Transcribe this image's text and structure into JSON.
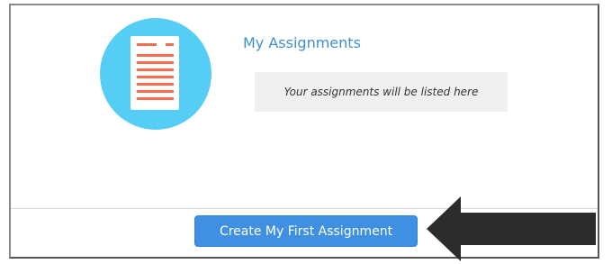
{
  "card": {
    "icon": "assignment-document-icon",
    "title": "My Assignments",
    "empty_message": "Your assignments will be listed here",
    "cta_label": "Create My First Assignment"
  },
  "annotation": {
    "icon": "left-arrow-pointer-icon"
  },
  "colors": {
    "icon_circle": "#55cdf4",
    "doc_lines": "#f07050",
    "title": "#3f8fd0",
    "button": "#3f8fe2",
    "arrow": "#2c2c2c"
  }
}
